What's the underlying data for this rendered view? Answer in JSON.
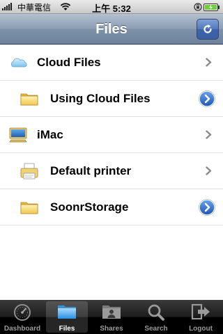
{
  "status_bar": {
    "carrier": "中華電信",
    "time": "上午 5:32"
  },
  "nav": {
    "title": "Files"
  },
  "list": [
    {
      "label": "Cloud Files",
      "icon": "cloud-icon",
      "accessory": "chevron",
      "indent": false
    },
    {
      "label": "Using Cloud Files",
      "icon": "folder-icon",
      "accessory": "detail-disclosure",
      "indent": true
    },
    {
      "label": "iMac",
      "icon": "computer-icon",
      "accessory": "chevron",
      "indent": false
    },
    {
      "label": "Default printer",
      "icon": "printer-icon",
      "accessory": "chevron",
      "indent": true
    },
    {
      "label": "SoonrStorage",
      "icon": "folder-icon",
      "accessory": "detail-disclosure",
      "indent": true
    }
  ],
  "tabs": [
    {
      "label": "Dashboard",
      "icon": "dashboard-icon",
      "active": false
    },
    {
      "label": "Files",
      "icon": "files-icon",
      "active": true
    },
    {
      "label": "Shares",
      "icon": "shares-icon",
      "active": false
    },
    {
      "label": "Search",
      "icon": "search-icon",
      "active": false
    },
    {
      "label": "Logout",
      "icon": "logout-icon",
      "active": false
    }
  ],
  "colors": {
    "nav_bar": "#8c9db4",
    "refresh_button": "#4a70b4",
    "disclosure_blue": "#2a66c6",
    "tab_bar": "#1c1c1c"
  }
}
